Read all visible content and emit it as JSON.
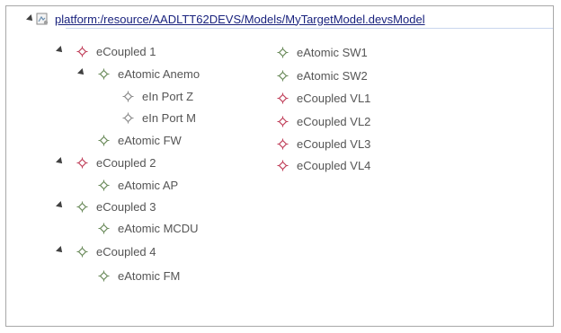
{
  "tree": {
    "root": {
      "label": "platform:/resource/AADLTT62DEVS/Models/MyTargetModel.devsModel",
      "icon": "model-file-icon"
    },
    "nodes": [
      {
        "label": "eCoupled 1",
        "icon": "coupled-diamond-icon",
        "color": "#c0405a",
        "expanded": true
      },
      {
        "label": "eAtomic Anemo",
        "icon": "atomic-diamond-icon",
        "color": "#6a8a5a",
        "expanded": true
      },
      {
        "label": "eIn Port Z",
        "icon": "port-diamond-icon",
        "color": "#8a8a8a",
        "expanded": false
      },
      {
        "label": "eIn Port M",
        "icon": "port-diamond-icon",
        "color": "#8a8a8a",
        "expanded": false
      },
      {
        "label": "eAtomic FW",
        "icon": "atomic-diamond-icon",
        "color": "#6a8a5a",
        "expanded": false
      },
      {
        "label": "eCoupled 2",
        "icon": "coupled-diamond-icon",
        "color": "#c0405a",
        "expanded": true
      },
      {
        "label": "eAtomic AP",
        "icon": "atomic-diamond-icon",
        "color": "#6a8a5a",
        "expanded": false
      },
      {
        "label": "eCoupled 3",
        "icon": "atomic-diamond-icon",
        "color": "#6a8a5a",
        "expanded": true
      },
      {
        "label": "eAtomic MCDU",
        "icon": "atomic-diamond-icon",
        "color": "#6a8a5a",
        "expanded": false
      },
      {
        "label": "eCoupled 4",
        "icon": "atomic-diamond-icon",
        "color": "#6a8a5a",
        "expanded": true
      },
      {
        "label": "eAtomic FM",
        "icon": "atomic-diamond-icon",
        "color": "#6a8a5a",
        "expanded": false
      },
      {
        "label": "eAtomic SW1",
        "icon": "atomic-diamond-icon",
        "color": "#6a8a5a",
        "expanded": false
      },
      {
        "label": "eAtomic SW2",
        "icon": "atomic-diamond-icon",
        "color": "#6a8a5a",
        "expanded": false
      },
      {
        "label": "eCoupled VL1",
        "icon": "coupled-diamond-icon",
        "color": "#c0405a",
        "expanded": false
      },
      {
        "label": "eCoupled VL2",
        "icon": "coupled-diamond-icon",
        "color": "#c0405a",
        "expanded": false
      },
      {
        "label": "eCoupled VL3",
        "icon": "coupled-diamond-icon",
        "color": "#c0405a",
        "expanded": false
      },
      {
        "label": "eCoupled VL4",
        "icon": "coupled-diamond-icon",
        "color": "#c0405a",
        "expanded": false
      }
    ]
  }
}
